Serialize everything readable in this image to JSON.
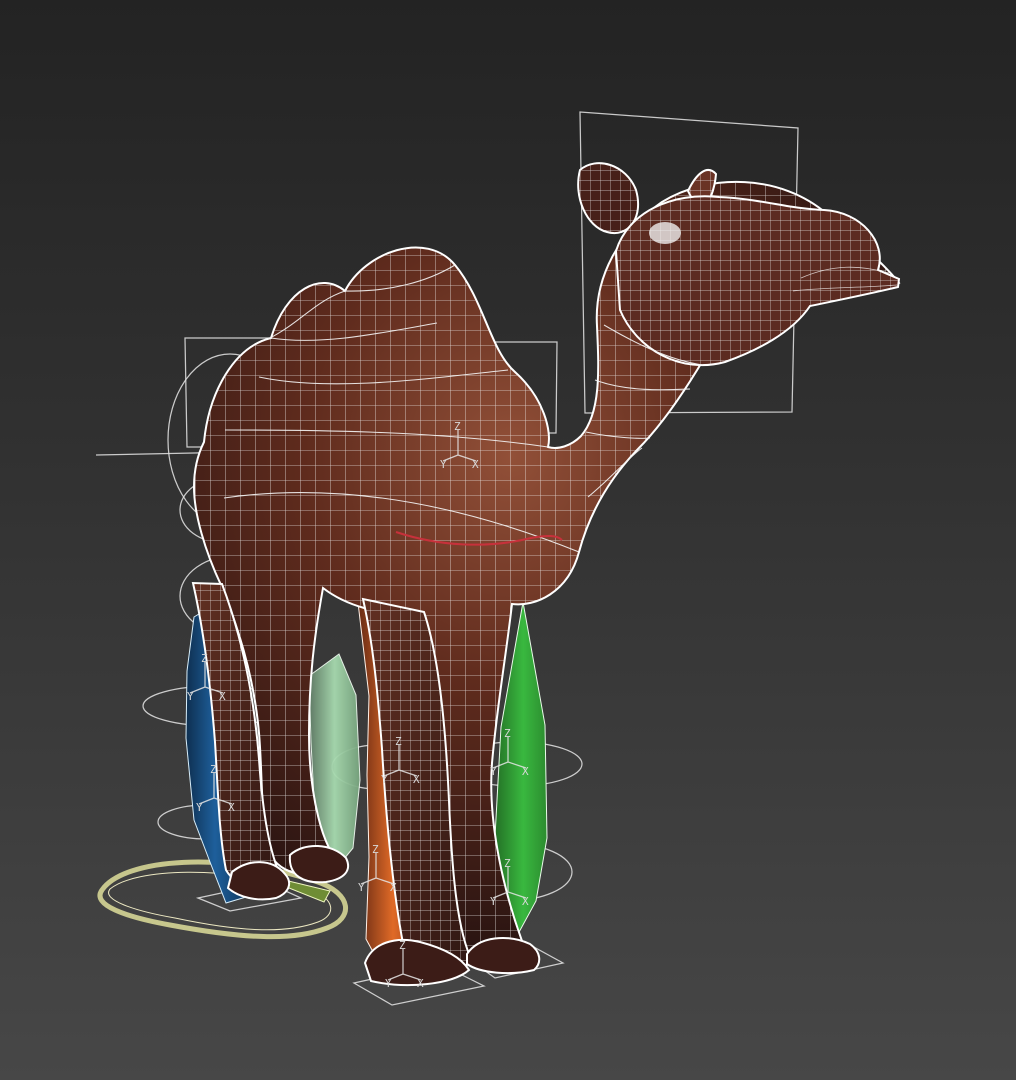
{
  "viewport": {
    "background_top": "#232323",
    "background_bottom": "#474747"
  },
  "rig": {
    "axis_letters": [
      "Z",
      "X",
      "Y"
    ],
    "bone_colors": {
      "left_front": "#1e5f9b",
      "right_front": "#e06a27",
      "back_left": "#9fd2a8",
      "back_right": "#39b83f",
      "body": "#6f351b"
    }
  }
}
